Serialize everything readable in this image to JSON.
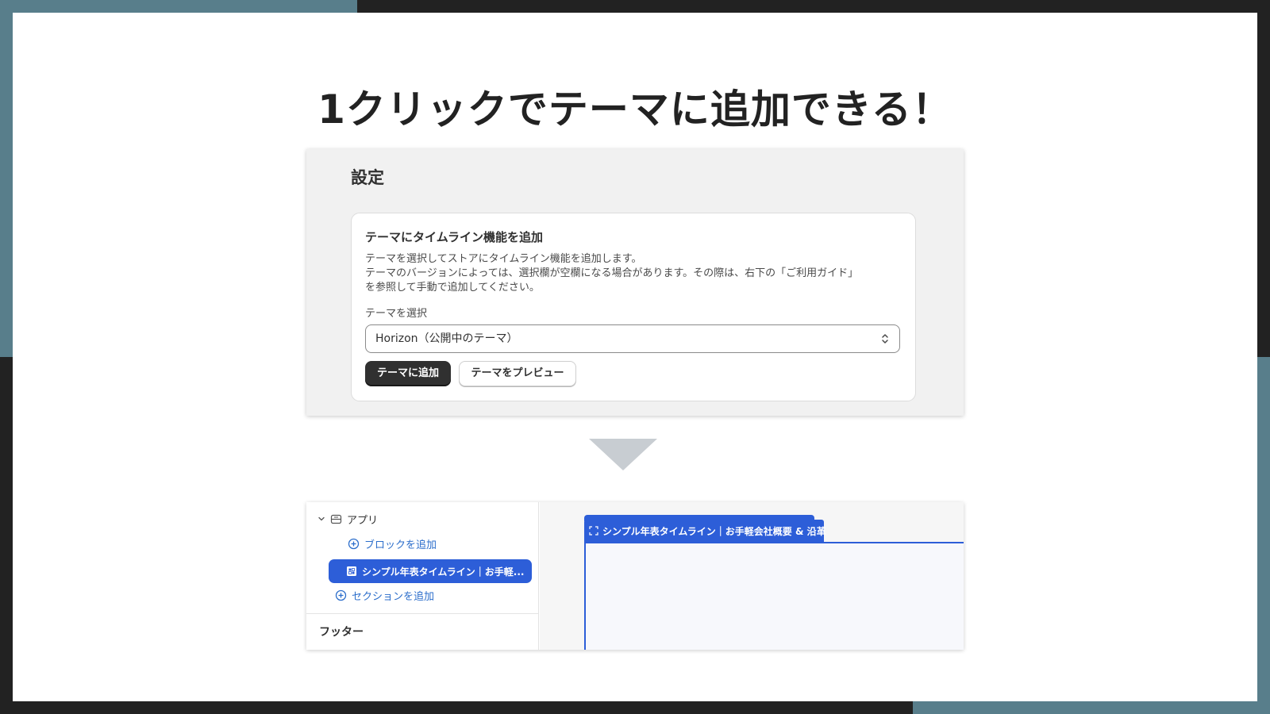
{
  "slide": {
    "headline": "1クリックでテーマに追加できる！"
  },
  "settings": {
    "title": "設定",
    "card": {
      "heading": "テーマにタイムライン機能を追加",
      "description_lines": [
        "テーマを選択してストアにタイムライン機能を追加します。",
        "テーマのバージョンによっては、選択欄が空欄になる場合があります。その際は、右下の「ご利用ガイド」",
        "を参照して手動で追加してください。"
      ],
      "select_label": "テーマを選択",
      "select_value": "Horizon（公開中のテーマ）",
      "add_button": "テーマに追加",
      "preview_button": "テーマをプレビュー"
    }
  },
  "editor": {
    "sidebar": {
      "app_group": "アプリ",
      "add_block": "ブロックを追加",
      "selected_block": "シンプル年表タイムライン｜お手軽...",
      "add_section": "セクションを追加",
      "footer_group": "フッター"
    },
    "preview": {
      "block_tab": "シンプル年表タイムライン｜お手軽会社概要 & 沿革"
    }
  },
  "colors": {
    "accent_blue": "#2d5ed8",
    "link_blue": "#2c6ecb",
    "frame_teal": "#587e8b",
    "frame_dark": "#222222"
  }
}
